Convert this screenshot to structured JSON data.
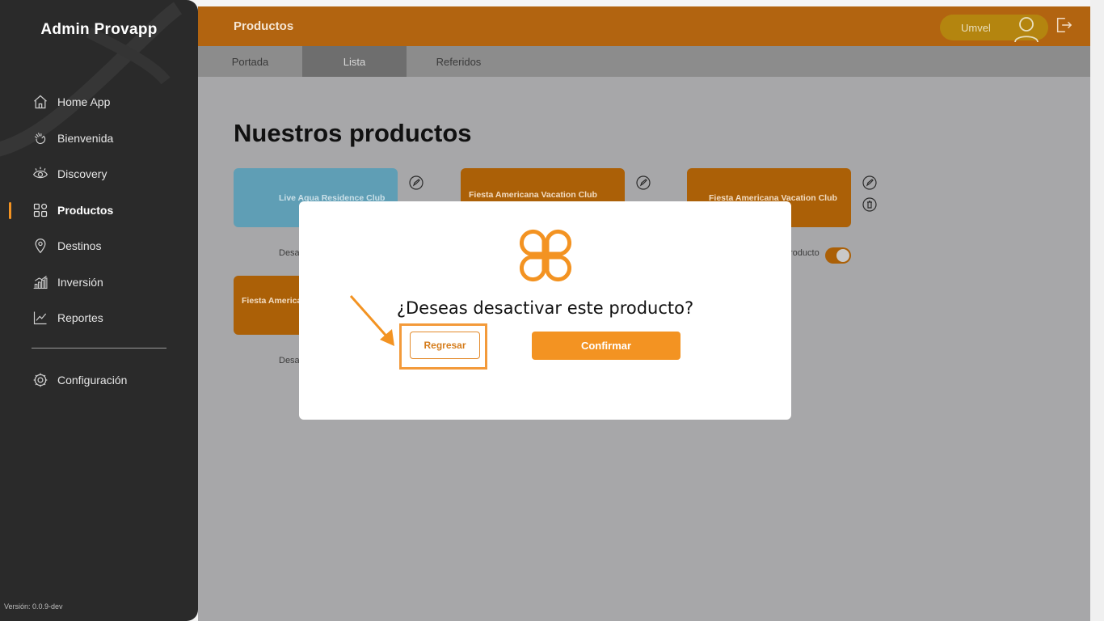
{
  "sidebar": {
    "title": "Admin Provapp",
    "items": [
      {
        "label": "Home App",
        "icon": "home-icon"
      },
      {
        "label": "Bienvenida",
        "icon": "wave-hand-icon"
      },
      {
        "label": "Discovery",
        "icon": "eye-icon"
      },
      {
        "label": "Productos",
        "icon": "grid-icon",
        "active": true
      },
      {
        "label": "Destinos",
        "icon": "location-pin-icon"
      },
      {
        "label": "Inversión",
        "icon": "bar-chart-icon"
      },
      {
        "label": "Reportes",
        "icon": "line-chart-icon"
      }
    ],
    "config_label": "Configuración",
    "version": "Versión: 0.0.9-dev"
  },
  "topbar": {
    "title": "Productos",
    "user_name": "Umvel"
  },
  "tabs": [
    {
      "label": "Portada"
    },
    {
      "label": "Lista",
      "active": true
    },
    {
      "label": "Referidos"
    }
  ],
  "main": {
    "page_title": "Nuestros productos",
    "cards": [
      {
        "label": "Live Aqua Residence Club",
        "color": "blue"
      },
      {
        "label": "Fiesta Americana Vacation Club Mexico",
        "color": "orange"
      },
      {
        "label": "Fiesta Americana Vacation Club",
        "color": "orange"
      },
      {
        "label": "Fiesta Americana Access",
        "color": "orange"
      }
    ],
    "deactivate_label_partial": "Desa",
    "deactivate_label_tail": "roducto"
  },
  "modal": {
    "question": "¿Deseas desactivar este producto?",
    "back_label": "Regresar",
    "confirm_label": "Confirmar"
  },
  "colors": {
    "accent": "#f39322",
    "topbar": "#b26410",
    "sidebar": "#2a2a2a"
  }
}
